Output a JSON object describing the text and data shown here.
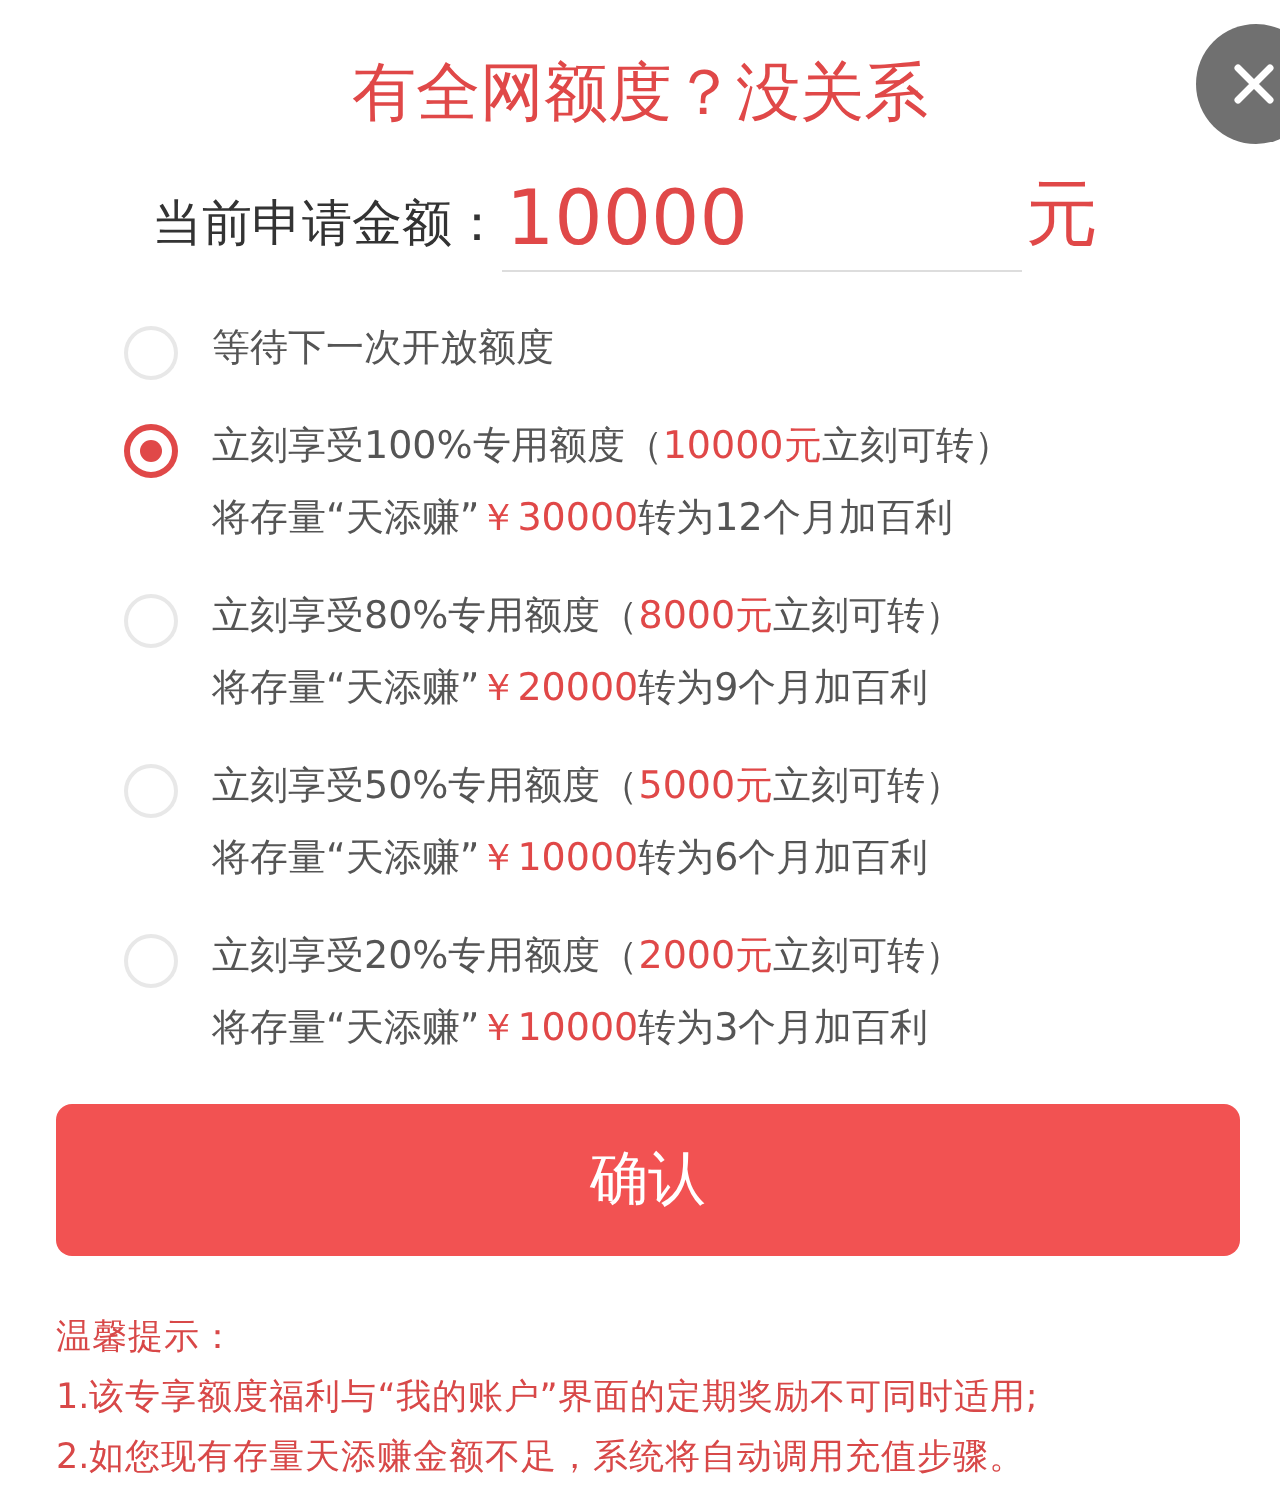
{
  "title": "有全网额度？没关系",
  "amount": {
    "label": "当前申请金额：",
    "value": "10000",
    "unit": "元"
  },
  "options": [
    {
      "selected": false,
      "lines": [
        {
          "before": "等待下一次开放额度"
        }
      ]
    },
    {
      "selected": true,
      "lines": [
        {
          "before": "立刻享受100%专用额度（",
          "highlight": "10000元",
          "after": "立刻可转）"
        },
        {
          "before": "将存量“天添赚”",
          "highlight": "￥30000",
          "after": "转为12个月加百利"
        }
      ]
    },
    {
      "selected": false,
      "lines": [
        {
          "before": "立刻享受80%专用额度（",
          "highlight": "8000元",
          "after": "立刻可转）"
        },
        {
          "before": "将存量“天添赚”",
          "highlight": "￥20000",
          "after": "转为9个月加百利"
        }
      ]
    },
    {
      "selected": false,
      "lines": [
        {
          "before": "立刻享受50%专用额度（",
          "highlight": "5000元",
          "after": "立刻可转）"
        },
        {
          "before": "将存量“天添赚”",
          "highlight": "￥10000",
          "after": "转为6个月加百利"
        }
      ]
    },
    {
      "selected": false,
      "lines": [
        {
          "before": "立刻享受20%专用额度（",
          "highlight": "2000元",
          "after": "立刻可转）"
        },
        {
          "before": "将存量“天添赚”",
          "highlight": "￥10000",
          "after": "转为3个月加百利"
        }
      ]
    }
  ],
  "confirm_button": "确认",
  "notes": [
    "温馨提示：",
    "1.该专享额度福利与“我的账户”界面的定期奖励不可同时适用;",
    "2.如您现有存量天添赚金额不足，系统将自动调用充值步骤。"
  ]
}
